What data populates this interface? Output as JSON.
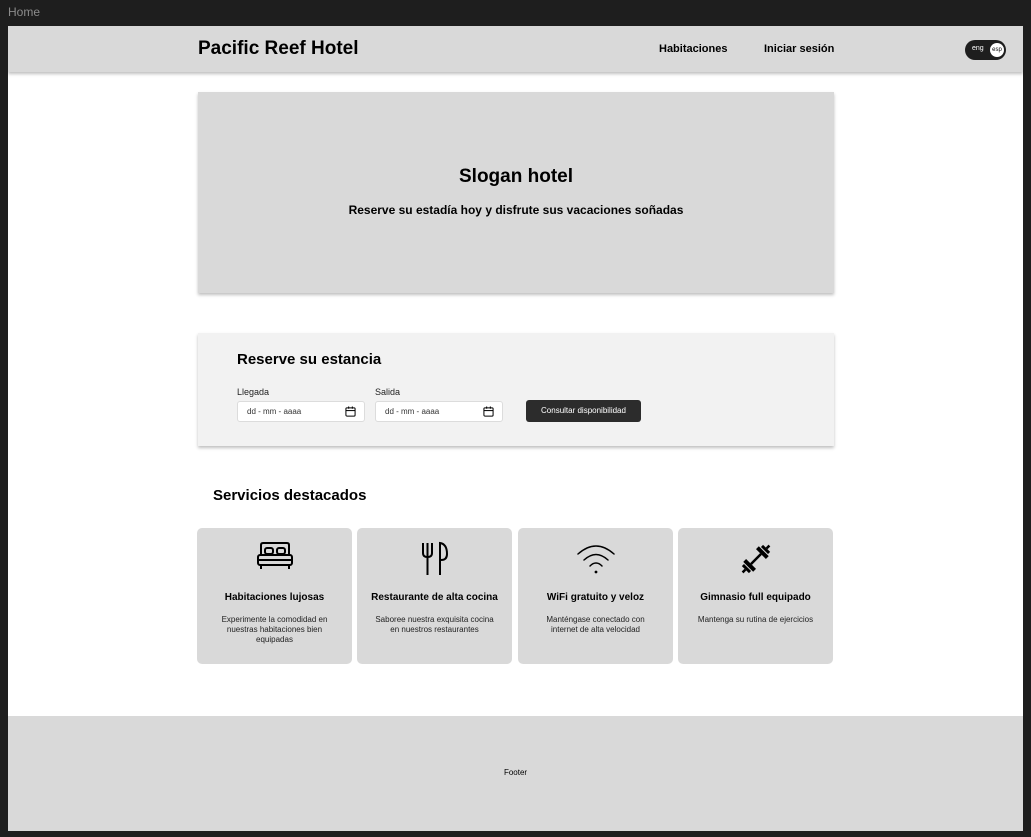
{
  "frame": {
    "label": "Home"
  },
  "header": {
    "brand": "Pacific Reef Hotel",
    "nav": {
      "rooms": "Habitaciones",
      "login": "Iniciar sesión"
    },
    "lang": {
      "eng": "eng",
      "esp": "esp",
      "selected": "esp"
    }
  },
  "hero": {
    "title": "Slogan hotel",
    "subtitle": "Reserve su estadía hoy y disfrute sus vacaciones soñadas"
  },
  "booking": {
    "title": "Reserve su estancia",
    "arrival_label": "Llegada",
    "arrival_placeholder": "dd - mm - aaaa",
    "departure_label": "Salida",
    "departure_placeholder": "dd - mm - aaaa",
    "button": "Consultar disponibilidad"
  },
  "services": {
    "title": "Servicios destacados",
    "items": [
      {
        "icon": "bed-icon",
        "title": "Habitaciones lujosas",
        "desc": "Experimente la comodidad en nuestras habitaciones bien equipadas"
      },
      {
        "icon": "utensils-icon",
        "title": "Restaurante de alta cocina",
        "desc": "Saboree nuestra exquisita cocina en nuestros restaurantes"
      },
      {
        "icon": "wifi-icon",
        "title": "WiFi gratuito y veloz",
        "desc": "Manténgase conectado con internet de alta velocidad"
      },
      {
        "icon": "dumbbell-icon",
        "title": "Gimnasio full equipado",
        "desc": "Mantenga su rutina de ejercicios"
      }
    ]
  },
  "footer": {
    "text": "Footer"
  }
}
